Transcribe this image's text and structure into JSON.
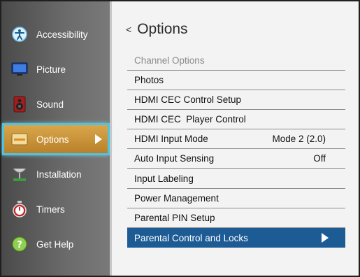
{
  "sidebar": {
    "items": [
      {
        "label": "Accessibility",
        "icon": "accessibility-icon"
      },
      {
        "label": "Picture",
        "icon": "picture-icon"
      },
      {
        "label": "Sound",
        "icon": "speaker-icon"
      },
      {
        "label": "Options",
        "icon": "options-icon",
        "selected": true
      },
      {
        "label": "Installation",
        "icon": "satellite-dish-icon"
      },
      {
        "label": "Timers",
        "icon": "stopwatch-icon"
      },
      {
        "label": "Get Help",
        "icon": "help-icon"
      }
    ]
  },
  "main": {
    "back_glyph": "<",
    "title": "Options",
    "section_header": "Channel Options",
    "menu": [
      {
        "label": "Photos",
        "value": ""
      },
      {
        "label": "HDMI CEC Control Setup",
        "value": ""
      },
      {
        "label": "HDMI CEC  Player Control",
        "value": ""
      },
      {
        "label": "HDMI Input Mode",
        "value": "Mode 2 (2.0)"
      },
      {
        "label": "Auto Input Sensing",
        "value": "Off"
      },
      {
        "label": "Input Labeling",
        "value": ""
      },
      {
        "label": "Power Management",
        "value": ""
      },
      {
        "label": "Parental PIN Setup",
        "value": ""
      },
      {
        "label": "Parental Control and Locks",
        "value": "",
        "selected": true
      }
    ]
  },
  "colors": {
    "selected_sidebar_bg": "#c8913a",
    "selection_outline": "#4fc3e0",
    "selected_row_bg": "#1d5b95",
    "sidebar_bg": "#5c5c5c"
  }
}
